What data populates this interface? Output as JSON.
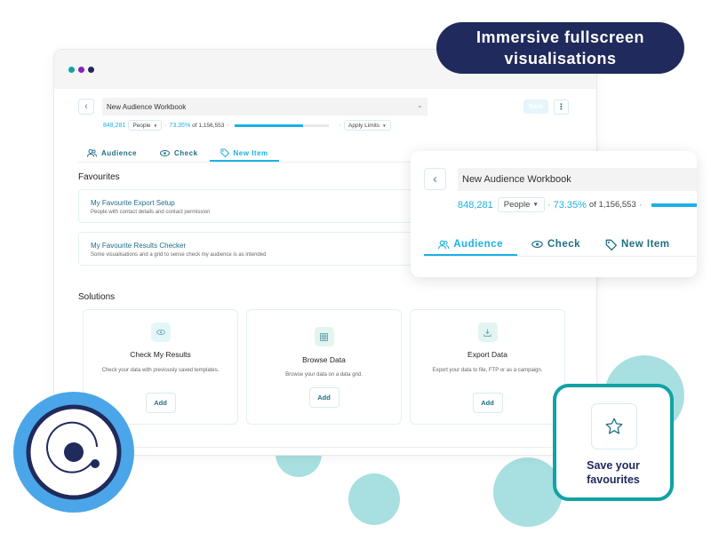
{
  "headline": {
    "line1": "Immersive fullscreen",
    "line2": "visualisations"
  },
  "window": {
    "dots": [
      {
        "name": "teal-dot",
        "color": "#0fa3a5"
      },
      {
        "name": "purple-dot",
        "color": "#8a1fbf"
      },
      {
        "name": "navy-dot",
        "color": "#202a5c"
      }
    ],
    "workbook_title": "New Audience Workbook",
    "stats": {
      "count": "848,281",
      "unit": "People",
      "percent": "73.35%",
      "of_total": "of 1,156,553",
      "progress_percent": 73.35,
      "apply_limits": "Apply Limits"
    },
    "save_label": "Save",
    "tabs": [
      {
        "label": "Audience",
        "icon": "users-icon",
        "active": false
      },
      {
        "label": "Check",
        "icon": "eye-icon",
        "active": false
      },
      {
        "label": "New Item",
        "icon": "tag-icon",
        "active": true
      }
    ],
    "favourites": {
      "title": "Favourites",
      "items": [
        {
          "title": "My Favourite Export Setup",
          "subtitle": "People with contact details and contact permission"
        },
        {
          "title": "My Favourite Results Checker",
          "subtitle": "Some visualisations and a grid to sense check my audience is as intended"
        }
      ]
    },
    "solutions": {
      "title": "Solutions",
      "items": [
        {
          "title": "Check My Results",
          "description": "Check your data with previously saved templates.",
          "icon": "eye-icon",
          "button": "Add"
        },
        {
          "title": "Browse Data",
          "description": "Browse your data on a data grid.",
          "icon": "grid-icon",
          "button": "Add"
        },
        {
          "title": "Export Data",
          "description": "Export your data to file, FTP or as a campaign.",
          "icon": "download-icon",
          "button": "Add"
        }
      ]
    }
  },
  "zoom_card": {
    "workbook_title": "New Audience Workbook",
    "stats": {
      "count": "848,281",
      "unit": "People",
      "percent": "73.35%",
      "of_total": "of 1,156,553"
    },
    "tabs": [
      {
        "label": "Audience",
        "icon": "users-icon",
        "active": true
      },
      {
        "label": "Check",
        "icon": "eye-icon",
        "active": false
      },
      {
        "label": "New Item",
        "icon": "tag-icon",
        "active": false
      }
    ]
  },
  "favourites_callout": {
    "line1": "Save your",
    "line2": "favourites"
  },
  "colors": {
    "accent": "#1ab1e6",
    "teal": "#0fa3a5",
    "navy": "#202a5c",
    "link": "#1e6f86",
    "bubble": "#a8dfe1",
    "logo_blue": "#4aa6e8"
  }
}
